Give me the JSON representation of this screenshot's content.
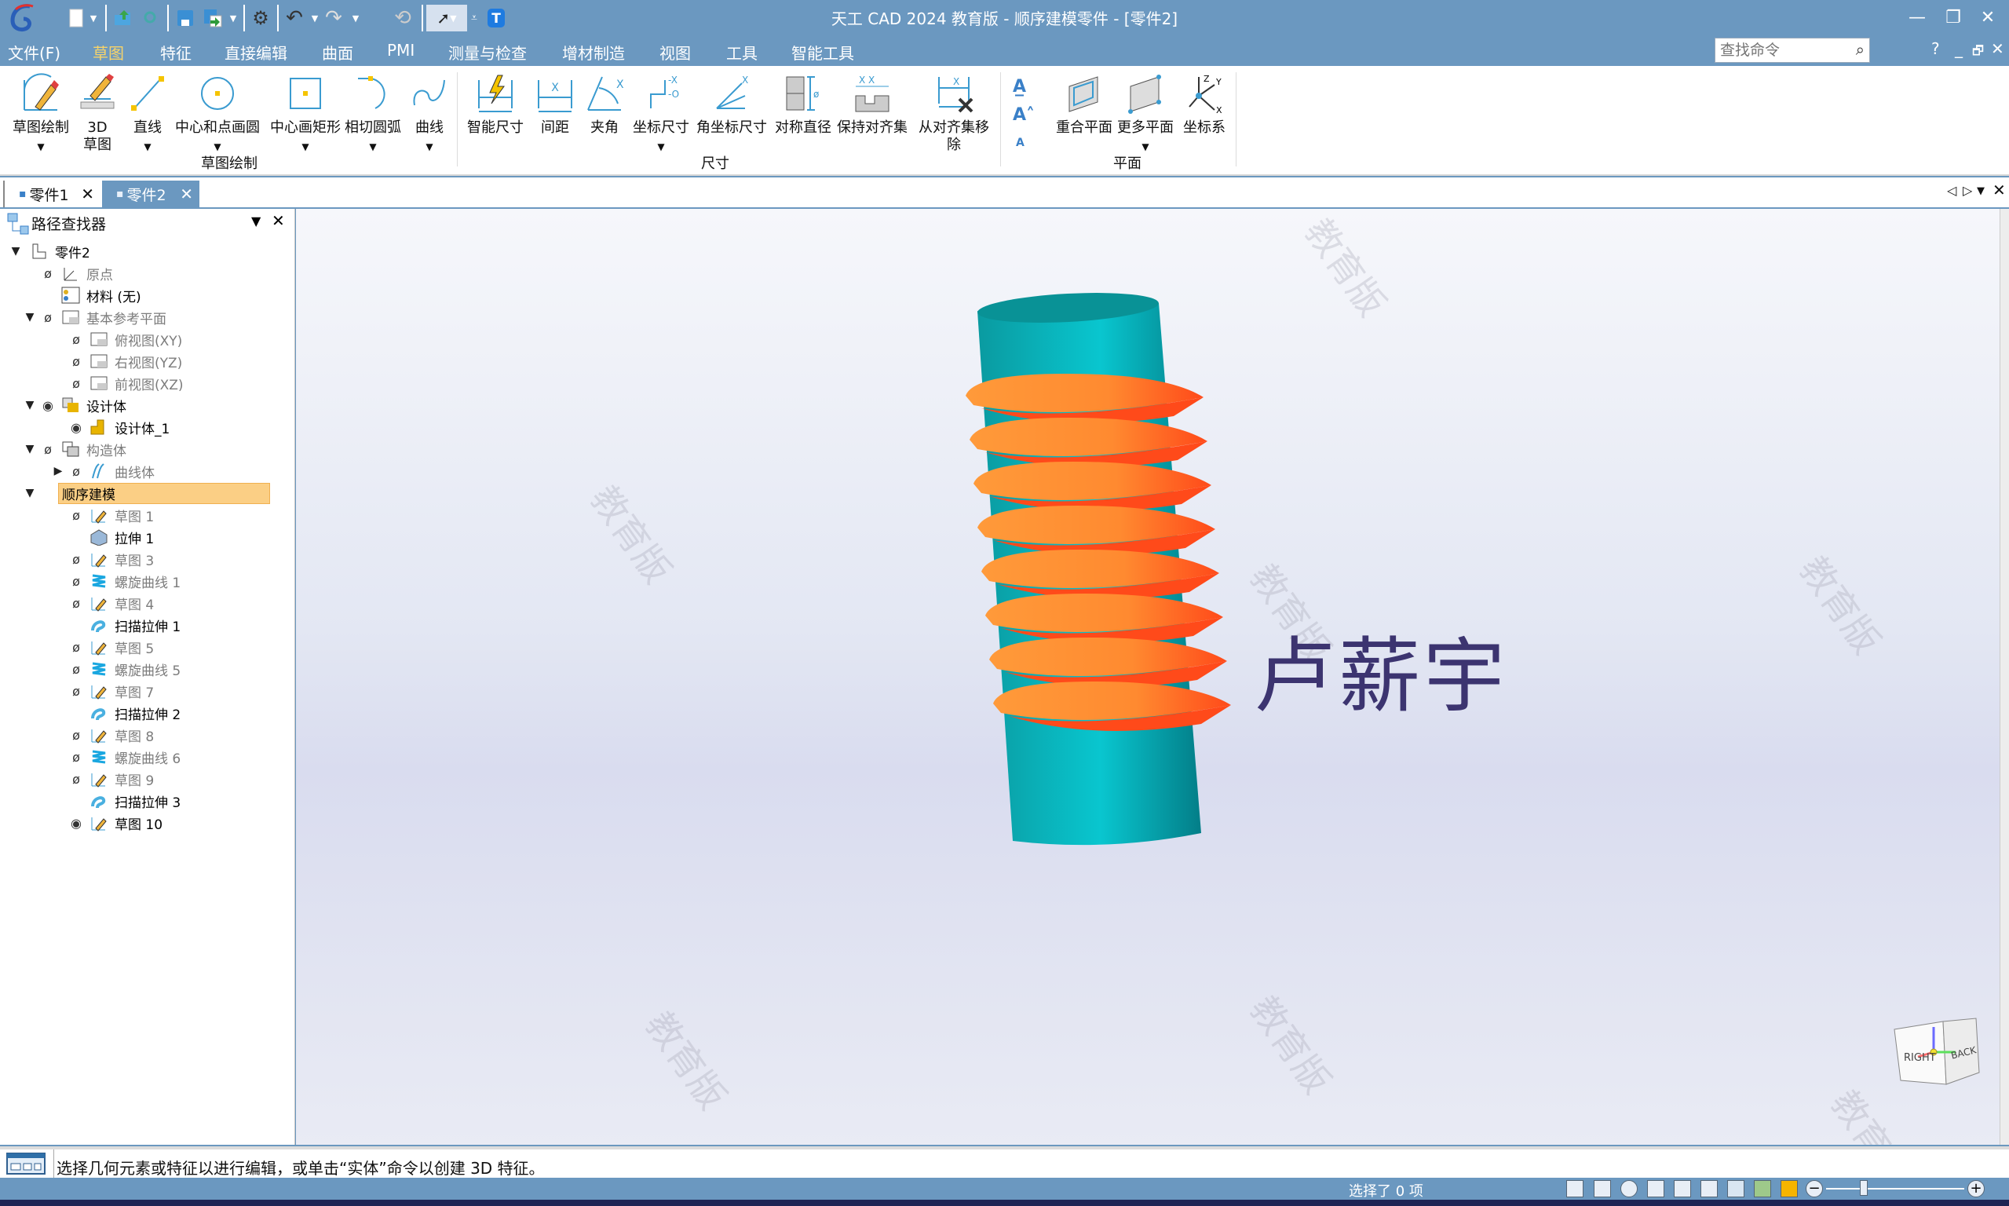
{
  "window": {
    "title": "天工 CAD 2024 教育版 - 顺序建模零件 - [零件2]",
    "controls": {
      "minimize": "—",
      "restore": "❐",
      "close": "✕"
    }
  },
  "quick_access": {
    "icons": [
      "new-document-icon",
      "open-icon",
      "search-file-icon",
      "save-icon",
      "save-as-icon",
      "settings-icon",
      "undo-icon",
      "redo-icon",
      "repeat-icon",
      "select-cursor-icon",
      "customize-icon",
      "text-t-icon"
    ]
  },
  "menu": {
    "items": [
      {
        "label": "文件(F)"
      },
      {
        "label": "草图",
        "active": true
      },
      {
        "label": "特征"
      },
      {
        "label": "直接编辑"
      },
      {
        "label": "曲面"
      },
      {
        "label": "PMI"
      },
      {
        "label": "测量与检查"
      },
      {
        "label": "增材制造"
      },
      {
        "label": "视图"
      },
      {
        "label": "工具"
      },
      {
        "label": "智能工具"
      }
    ],
    "search_placeholder": "查找命令",
    "help": "?",
    "mdi_min": "_",
    "mdi_restore": "🗗",
    "mdi_close": "✕"
  },
  "ribbon": {
    "groups": [
      {
        "label": "草图绘制",
        "buttons": [
          {
            "label": "草图绘制",
            "icon": "sketch-draw-icon",
            "dropdown": true
          },
          {
            "label": "3D\n草图",
            "icon": "3d-sketch-icon",
            "dropdown": false
          },
          {
            "label": "直线",
            "icon": "line-icon",
            "dropdown": true
          },
          {
            "label": "中心和点画圆",
            "icon": "circle-center-point-icon",
            "dropdown": true
          },
          {
            "label": "中心画矩形",
            "icon": "center-rectangle-icon",
            "dropdown": true
          },
          {
            "label": "相切圆弧",
            "icon": "tangent-arc-icon",
            "dropdown": true
          },
          {
            "label": "曲线",
            "icon": "curve-icon",
            "dropdown": true
          }
        ]
      },
      {
        "label": "尺寸",
        "buttons": [
          {
            "label": "智能尺寸",
            "icon": "smart-dimension-icon"
          },
          {
            "label": "间距",
            "icon": "distance-icon"
          },
          {
            "label": "夹角",
            "icon": "angle-icon"
          },
          {
            "label": "坐标尺寸",
            "icon": "coordinate-dimension-icon",
            "dropdown": true
          },
          {
            "label": "角坐标尺寸",
            "icon": "angular-coordinate-icon"
          },
          {
            "label": "对称直径",
            "icon": "symmetric-diameter-icon"
          },
          {
            "label": "保持对齐集",
            "icon": "keep-alignment-icon"
          },
          {
            "label": "从对齐集移除",
            "icon": "remove-alignment-icon"
          }
        ]
      },
      {
        "label": "平面",
        "buttons": [
          {
            "label": "重合平面",
            "icon": "coincident-plane-icon"
          },
          {
            "label": "更多平面",
            "icon": "more-planes-icon",
            "dropdown": true
          },
          {
            "label": "坐标系",
            "icon": "coordinate-system-icon"
          }
        ]
      }
    ],
    "text_tools": [
      "text-style-icon",
      "text-size-up-icon",
      "text-size-down-icon"
    ]
  },
  "doc_tabs": [
    {
      "label": "零件1",
      "active": false
    },
    {
      "label": "零件2",
      "active": true
    }
  ],
  "tab_nav": {
    "prev": "◁",
    "next": "▷",
    "menu": "▼",
    "close": "✕"
  },
  "pathfinder": {
    "title": "路径查找器",
    "tree": [
      {
        "label": "零件2",
        "level": 0,
        "expander": "▼",
        "eye": "",
        "icon": "part-icon",
        "style": "bold"
      },
      {
        "label": "原点",
        "level": 1,
        "expander": "",
        "eye": "hidden",
        "icon": "origin-axes-icon",
        "style": "dim"
      },
      {
        "label": "材料 (无)",
        "level": 1,
        "expander": "",
        "eye": "",
        "icon": "material-icon",
        "style": "bold"
      },
      {
        "label": "基本参考平面",
        "level": 1,
        "expander": "▼",
        "eye": "hidden",
        "icon": "plane-icon",
        "style": "dim"
      },
      {
        "label": "俯视图(XY)",
        "level": 2,
        "expander": "",
        "eye": "hidden",
        "icon": "plane-icon",
        "style": "dim"
      },
      {
        "label": "右视图(YZ)",
        "level": 2,
        "expander": "",
        "eye": "hidden",
        "icon": "plane-icon",
        "style": "dim"
      },
      {
        "label": "前视图(XZ)",
        "level": 2,
        "expander": "",
        "eye": "hidden",
        "icon": "plane-icon",
        "style": "dim"
      },
      {
        "label": "设计体",
        "level": 1,
        "expander": "▼",
        "eye": "visible",
        "icon": "design-body-icon",
        "style": "bold"
      },
      {
        "label": "设计体_1",
        "level": 2,
        "expander": "",
        "eye": "visible",
        "icon": "design-body-item-icon",
        "style": "bold"
      },
      {
        "label": "构造体",
        "level": 1,
        "expander": "▼",
        "eye": "hidden",
        "icon": "construction-body-icon",
        "style": "dim"
      },
      {
        "label": "曲线体",
        "level": 2,
        "expander": "▶",
        "eye": "hidden",
        "icon": "curve-body-icon",
        "style": "dim"
      },
      {
        "label": "顺序建模",
        "level": 1,
        "expander": "▼",
        "eye": "",
        "icon": "",
        "style": "bold",
        "selected": true
      },
      {
        "label": "草图 1",
        "level": 2,
        "expander": "",
        "eye": "hidden",
        "icon": "sketch-icon",
        "style": "dim"
      },
      {
        "label": "拉伸 1",
        "level": 2,
        "expander": "",
        "eye": "",
        "icon": "extrude-icon",
        "style": "bold"
      },
      {
        "label": "草图 3",
        "level": 2,
        "expander": "",
        "eye": "hidden",
        "icon": "sketch-icon",
        "style": "dim"
      },
      {
        "label": "螺旋曲线 1",
        "level": 2,
        "expander": "",
        "eye": "hidden",
        "icon": "helix-icon",
        "style": "dim"
      },
      {
        "label": "草图 4",
        "level": 2,
        "expander": "",
        "eye": "hidden",
        "icon": "sketch-icon",
        "style": "dim"
      },
      {
        "label": "扫描拉伸 1",
        "level": 2,
        "expander": "",
        "eye": "",
        "icon": "sweep-icon",
        "style": "bold"
      },
      {
        "label": "草图 5",
        "level": 2,
        "expander": "",
        "eye": "hidden",
        "icon": "sketch-icon",
        "style": "dim"
      },
      {
        "label": "螺旋曲线 5",
        "level": 2,
        "expander": "",
        "eye": "hidden",
        "icon": "helix-icon",
        "style": "dim"
      },
      {
        "label": "草图 7",
        "level": 2,
        "expander": "",
        "eye": "hidden",
        "icon": "sketch-icon",
        "style": "dim"
      },
      {
        "label": "扫描拉伸 2",
        "level": 2,
        "expander": "",
        "eye": "",
        "icon": "sweep-icon",
        "style": "bold"
      },
      {
        "label": "草图 8",
        "level": 2,
        "expander": "",
        "eye": "hidden",
        "icon": "sketch-icon",
        "style": "dim"
      },
      {
        "label": "螺旋曲线 6",
        "level": 2,
        "expander": "",
        "eye": "hidden",
        "icon": "helix-icon",
        "style": "dim"
      },
      {
        "label": "草图 9",
        "level": 2,
        "expander": "",
        "eye": "hidden",
        "icon": "sketch-icon",
        "style": "dim"
      },
      {
        "label": "扫描拉伸 3",
        "level": 2,
        "expander": "",
        "eye": "",
        "icon": "sweep-icon",
        "style": "bold"
      },
      {
        "label": "草图 10",
        "level": 2,
        "expander": "",
        "eye": "visible",
        "icon": "sketch-icon",
        "style": "bold"
      }
    ]
  },
  "viewport": {
    "model": "threaded-cylinder",
    "thread_count": 8,
    "colors": {
      "cylinder": "#07b5bf",
      "thread_top": "#ff9238",
      "thread_under": "#ff4a1a"
    },
    "signature_text": "卢薪宇",
    "watermark": "教育版",
    "view_cube": {
      "face_right": "RIGHT",
      "face_back": "BACK"
    }
  },
  "prompt_bar": {
    "text": "选择几何元素或特征以进行编辑，或单击“实体”命令以创建 3D 特征。"
  },
  "status_bar": {
    "selection": "选择了 0 项",
    "tools": [
      "snapshot-icon",
      "zoom-area-icon",
      "zoom-icon",
      "fit-icon",
      "pan-icon",
      "rotate-icon",
      "view-orient-icon",
      "shaded-icon",
      "display-mode-icon"
    ],
    "zoom_minus": "−",
    "zoom_plus": "+",
    "zoom_slider_fraction": 0.27
  }
}
